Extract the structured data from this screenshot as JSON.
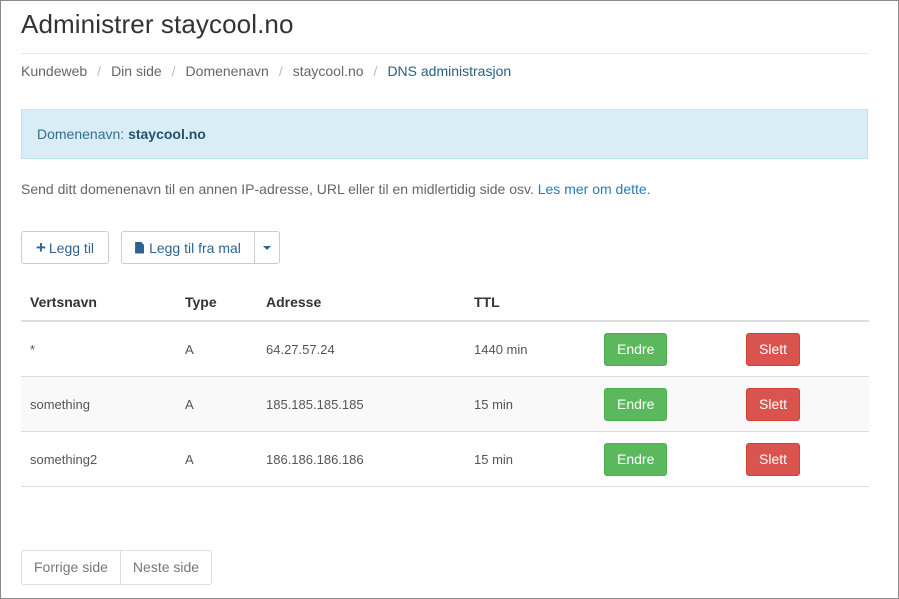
{
  "title": "Administrer staycool.no",
  "breadcrumb": [
    "Kundeweb",
    "Din side",
    "Domenenavn",
    "staycool.no",
    "DNS administrasjon"
  ],
  "alert": {
    "label": "Domenenavn:",
    "domain": "staycool.no"
  },
  "lead": {
    "text": "Send ditt domenenavn til en annen IP-adresse, URL eller til en midlertidig side osv.",
    "link": "Les mer om dette."
  },
  "toolbar": {
    "add_label": "Legg til",
    "template_label": "Legg til fra mal"
  },
  "table": {
    "headers": [
      "Vertsnavn",
      "Type",
      "Adresse",
      "TTL"
    ],
    "rows": [
      {
        "host": "*",
        "type": "A",
        "address": "64.27.57.24",
        "ttl": "1440 min"
      },
      {
        "host": "something",
        "type": "A",
        "address": "185.185.185.185",
        "ttl": "15 min"
      },
      {
        "host": "something2",
        "type": "A",
        "address": "186.186.186.186",
        "ttl": "15 min"
      }
    ],
    "edit_label": "Endre",
    "delete_label": "Slett"
  },
  "pagination": {
    "prev": "Forrige side",
    "next": "Neste side"
  }
}
